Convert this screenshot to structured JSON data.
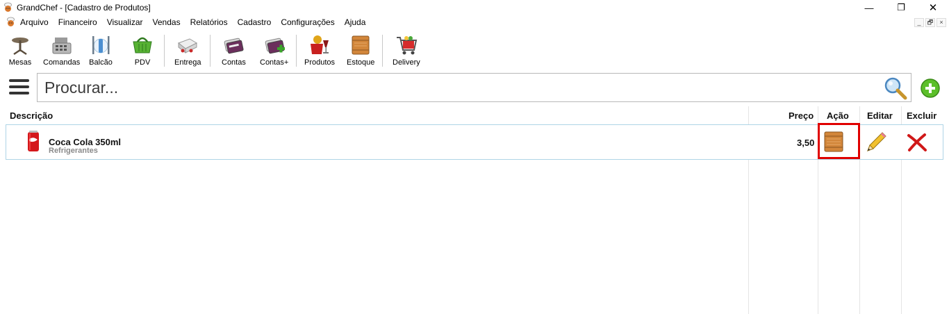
{
  "window": {
    "title": "GrandChef - [Cadastro de Produtos]",
    "minimize": "—",
    "maximize": "❐",
    "close": "✕"
  },
  "menu": {
    "items": [
      "Arquivo",
      "Financeiro",
      "Visualizar",
      "Vendas",
      "Relatórios",
      "Cadastro",
      "Configurações",
      "Ajuda"
    ],
    "mdi": [
      "_",
      "🗗",
      "×"
    ]
  },
  "toolbar": {
    "buttons": [
      {
        "label": "Mesas",
        "icon": "table-icon"
      },
      {
        "label": "Comandas",
        "icon": "cash-register-icon"
      },
      {
        "label": "Balcão",
        "icon": "cutlery-icon"
      },
      {
        "label": "PDV",
        "icon": "basket-icon"
      },
      {
        "label": "Entrega",
        "icon": "delivery-truck-icon"
      },
      {
        "label": "Contas",
        "icon": "cards-icon"
      },
      {
        "label": "Contas+",
        "icon": "cards-add-icon"
      },
      {
        "label": "Produtos",
        "icon": "products-icon"
      },
      {
        "label": "Estoque",
        "icon": "box-icon"
      },
      {
        "label": "Delivery",
        "icon": "shopping-cart-icon"
      }
    ]
  },
  "search": {
    "placeholder": "Procurar..."
  },
  "table": {
    "headers": {
      "description": "Descrição",
      "price": "Preço",
      "action": "Ação",
      "edit": "Editar",
      "delete": "Excluir"
    },
    "rows": [
      {
        "name": "Coca Cola 350ml",
        "category": "Refrigerantes",
        "price": "3,50"
      }
    ]
  },
  "colors": {
    "row_border": "#aed4e6",
    "highlight": "#e00000",
    "add_green": "#5cbf2a",
    "delete_red": "#d01818"
  }
}
